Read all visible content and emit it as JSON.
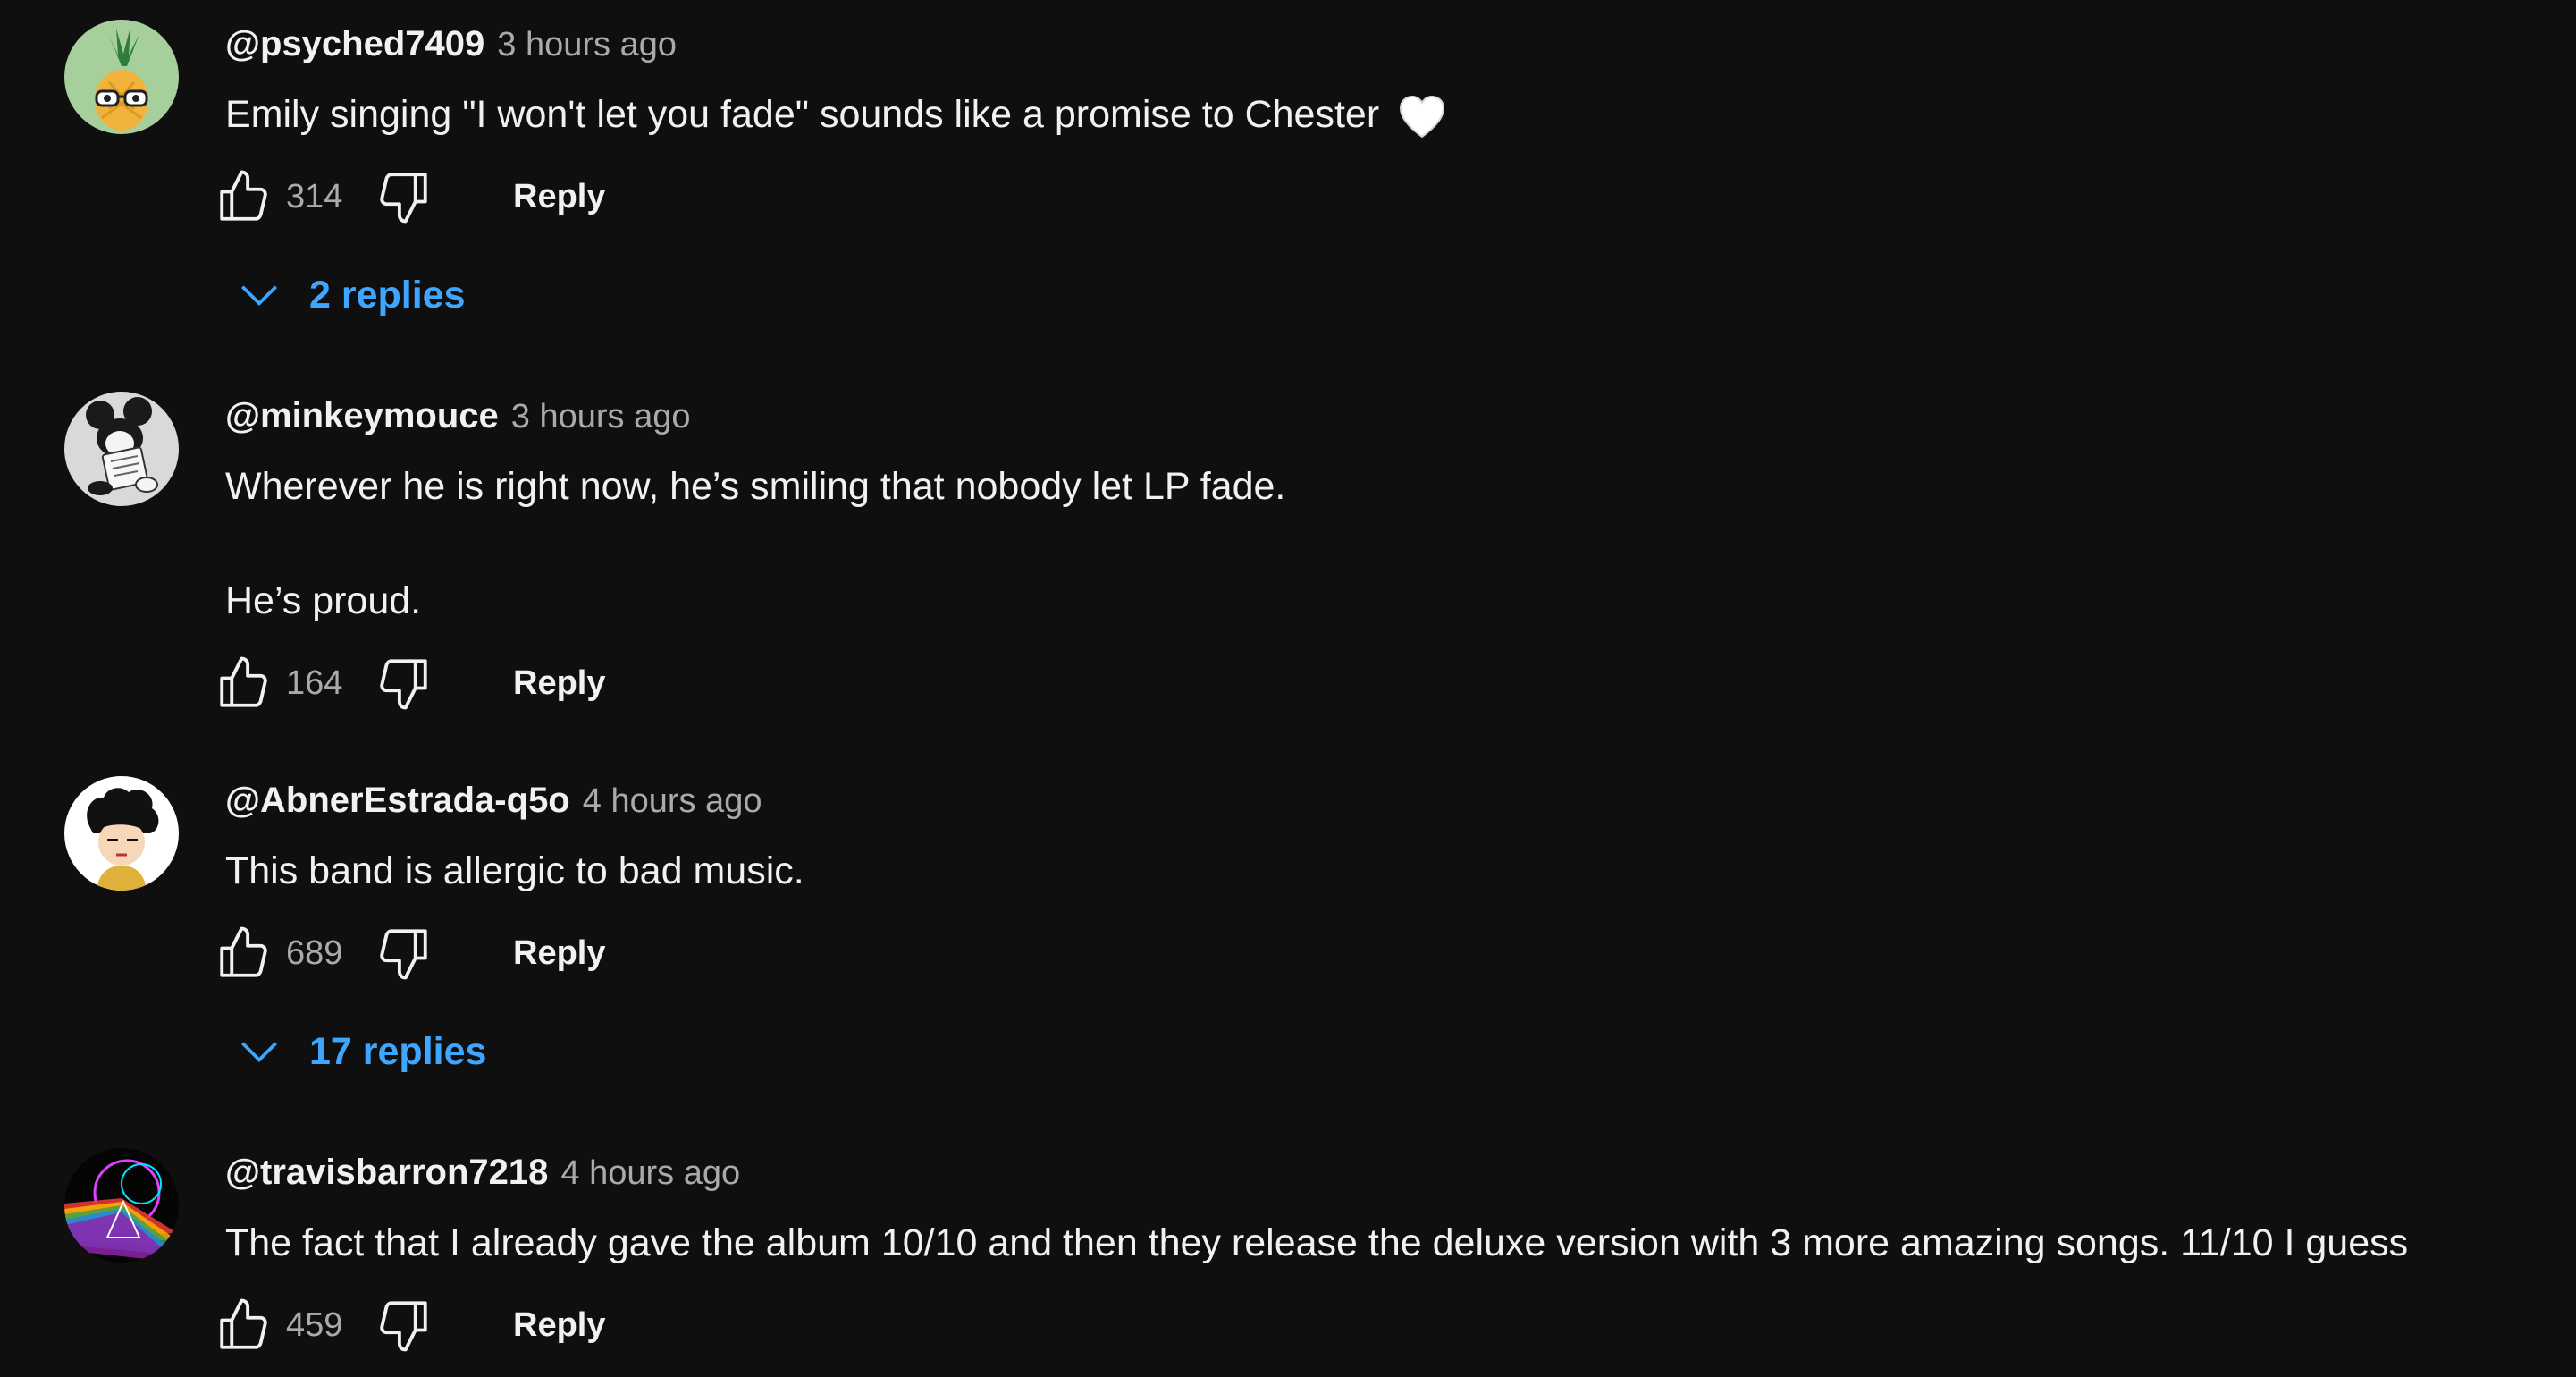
{
  "comments": [
    {
      "author": "@psyched7409",
      "time": "3 hours ago",
      "text": "Emily singing \"I won't let you fade\" sounds like a promise to Chester",
      "likes": "314",
      "reply_label": "Reply",
      "replies_label": "2 replies",
      "avatar_icon": "pineapple-avatar",
      "trailing_emoji": "white-heart-icon"
    },
    {
      "author": "@minkeymouce",
      "time": "3 hours ago",
      "text": "Wherever he is right now, he’s smiling that nobody let LP fade.\n\nHe’s proud.",
      "likes": "164",
      "reply_label": "Reply",
      "avatar_icon": "mouse-reading-avatar"
    },
    {
      "author": "@AbnerEstrada-q5o",
      "time": "4 hours ago",
      "text": "This band is allergic to bad music.",
      "likes": "689",
      "reply_label": "Reply",
      "replies_label": "17 replies",
      "avatar_icon": "cartoon-boy-avatar"
    },
    {
      "author": "@travisbarron7218",
      "time": "4 hours ago",
      "text": "The fact that I already gave the album 10/10 and then they release the deluxe version with 3 more amazing songs. 11/10 I guess",
      "likes": "459",
      "reply_label": "Reply",
      "avatar_icon": "rainbow-prism-avatar"
    }
  ],
  "colors": {
    "background": "#0f0f0f",
    "text": "#f1f1f1",
    "secondary_text": "#aaaaaa",
    "link": "#3ea6ff"
  }
}
